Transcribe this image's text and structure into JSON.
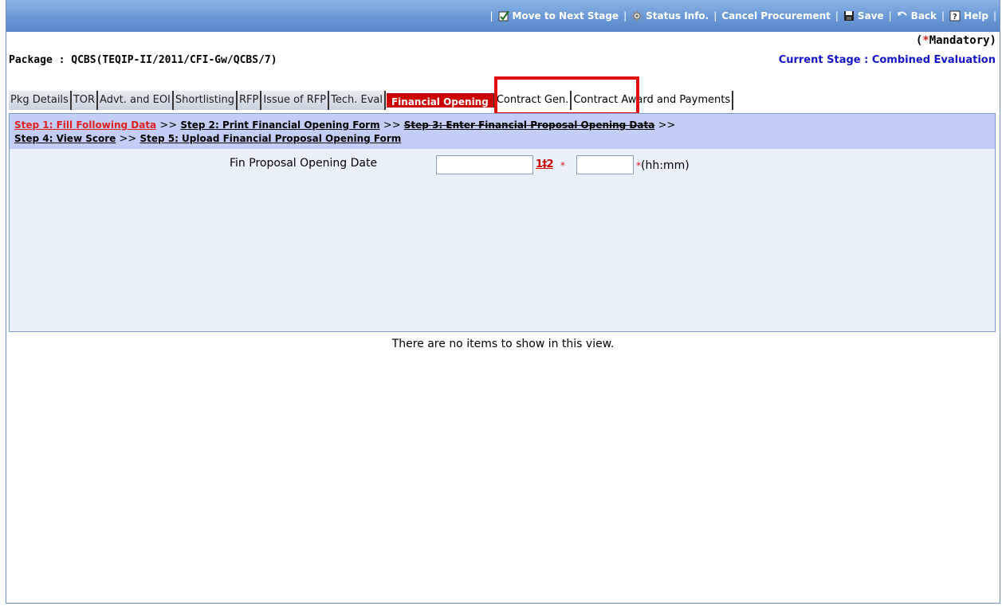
{
  "toolbar": {
    "move_next": "Move to Next Stage",
    "status_info": "Status Info.",
    "cancel_procurement": "Cancel Procurement",
    "save": "Save",
    "back": "Back",
    "help": "Help"
  },
  "header": {
    "mandatory_text": "Mandatory)",
    "mandatory_open": "(",
    "mandatory_star": "*",
    "package": "Package : QCBS(TEQIP-II/2011/CFI-Gw/QCBS/7)",
    "current_stage": "Current Stage : Combined Evaluation"
  },
  "tabs": [
    {
      "label": "Pkg Details"
    },
    {
      "label": "TOR"
    },
    {
      "label": "Advt. and EOI"
    },
    {
      "label": "Shortlisting"
    },
    {
      "label": "RFP"
    },
    {
      "label": "Issue of RFP"
    },
    {
      "label": "Tech. Eval"
    },
    {
      "label": "Financial Opening"
    },
    {
      "label": "Contract Gen."
    },
    {
      "label": "Contract Award and Payments"
    }
  ],
  "steps": {
    "step1": "Step 1: Fill Following Data",
    "step2": "Step 2: Print Financial Opening Form",
    "step3": "Step 3: Enter Financial Proposal Opening Data",
    "step4": "Step 4: View Score",
    "step5": "Step 5: Upload Financial Proposal Opening Form",
    "separator": ">>"
  },
  "form": {
    "fin_label": "Fin Proposal Opening Date",
    "date_value": "",
    "calendar_icon_text": "1‡2",
    "required_star": "*",
    "time_value": "",
    "time_format": "(hh:mm)"
  },
  "empty_message": "There are no items to show in this view.",
  "colors": {
    "toolbar": "#6a98d6",
    "active_tab": "#cc0000",
    "steps_bg": "#c4cdf5",
    "panel_bg": "#eaf1fb",
    "stage_text": "#1515c8",
    "highlight": "#e01010"
  }
}
